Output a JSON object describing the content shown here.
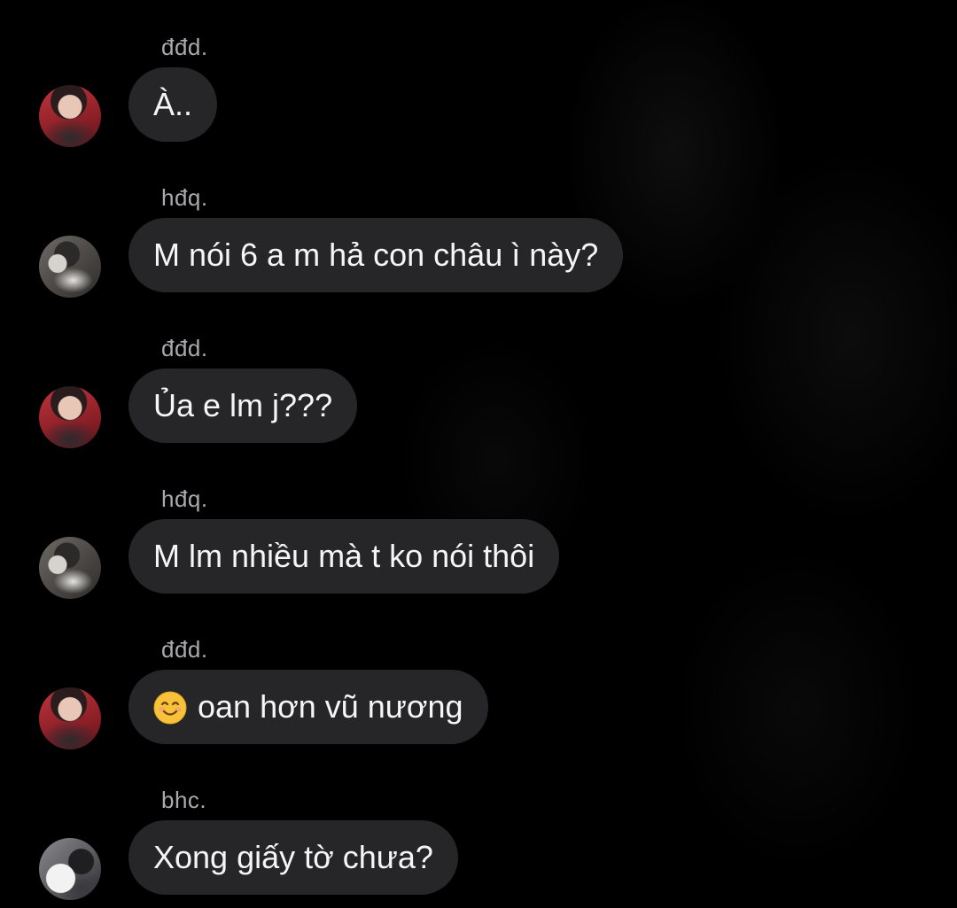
{
  "messages": [
    {
      "sender": "đđd.",
      "text": "À..",
      "avatar": "red-portrait",
      "emoji": null
    },
    {
      "sender": "hđq.",
      "text": "M nói 6 a m hả con châu ì này?",
      "avatar": "gray-portrait",
      "emoji": null
    },
    {
      "sender": "đđd.",
      "text": "Ủa e lm j???",
      "avatar": "red-portrait",
      "emoji": null
    },
    {
      "sender": "hđq.",
      "text": "M lm nhiều mà t ko nói thôi",
      "avatar": "gray-portrait",
      "emoji": null
    },
    {
      "sender": "đđd.",
      "text": "oan hơn vũ nương",
      "avatar": "red-portrait",
      "emoji": "smiling-face-emoji"
    },
    {
      "sender": "bhc.",
      "text": "Xong giấy tờ chưa?",
      "avatar": "dog-portrait",
      "emoji": null
    }
  ],
  "colors": {
    "background": "#000000",
    "bubble": "#262629",
    "sender_text": "#a9a9ae",
    "message_text": "#f5f5f7"
  }
}
